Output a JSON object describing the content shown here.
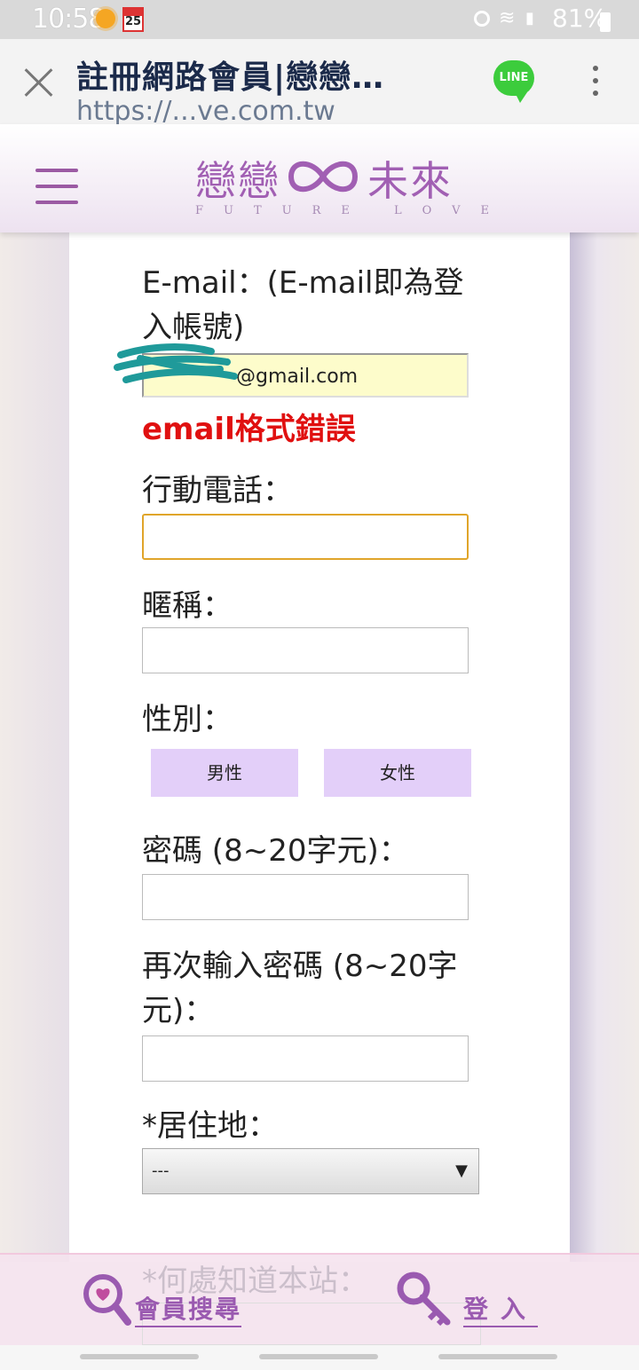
{
  "status_bar": {
    "time": "10:58",
    "calendar_day": "25",
    "battery": "81%"
  },
  "browser": {
    "page_title": "註冊網路會員|戀戀…",
    "url": "https://...ve.com.tw",
    "line_label": "LINE"
  },
  "site": {
    "logo_cn_left": "戀戀",
    "logo_cn_right": "未來",
    "logo_en": "FUTURE LOVE"
  },
  "form": {
    "email_label": "E-mail：(E-mail即為登入帳號)",
    "email_value": "@gmail.com",
    "email_error": "email格式錯誤",
    "phone_label": "行動電話：",
    "phone_value": "",
    "nickname_label": "暱稱：",
    "nickname_value": "",
    "gender_label": "性別：",
    "gender_male": "男性",
    "gender_female": "女性",
    "password_label": "密碼 (8~20字元)：",
    "password_value": "",
    "password_confirm_label": "再次輸入密碼 (8~20字元)：",
    "password_confirm_value": "",
    "residence_label": "*居住地：",
    "residence_selected": "---",
    "source_label": "*何處知道本站："
  },
  "bottom_nav": {
    "search_label": "會員搜尋",
    "login_label": "登入"
  },
  "colors": {
    "brand_purple": "#9a5ab0",
    "error_red": "#e01010",
    "gender_button_bg": "#e3cff9",
    "email_field_bg": "#fdfccb",
    "phone_focus_border": "#e0a52a"
  }
}
